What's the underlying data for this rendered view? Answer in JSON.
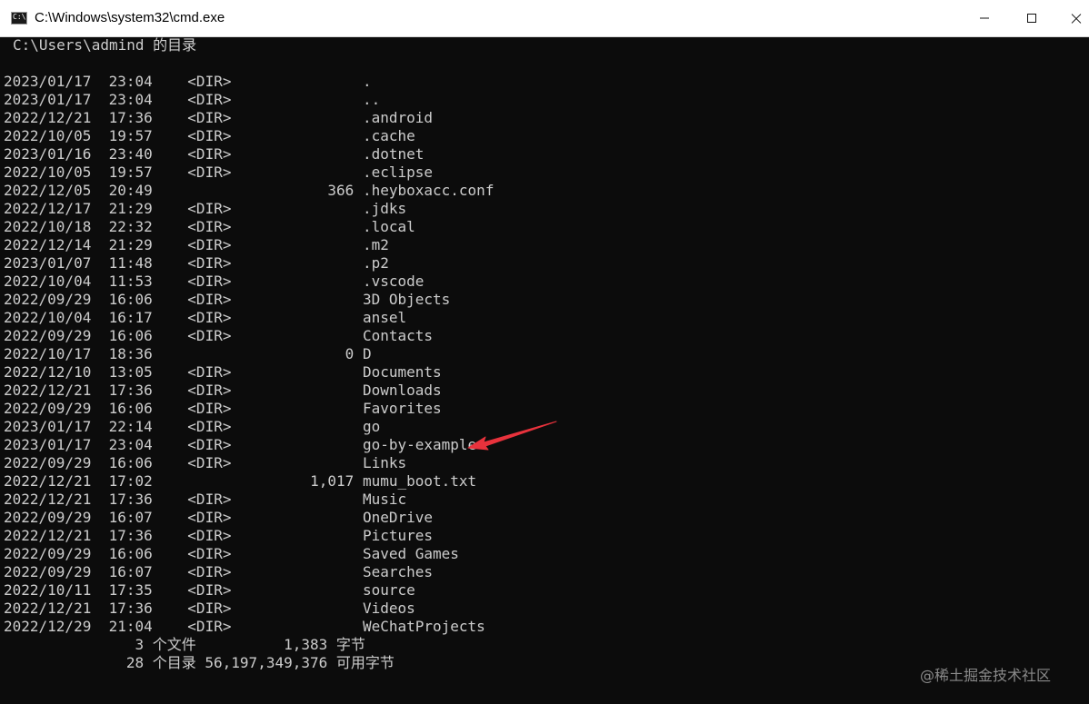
{
  "window": {
    "title": "C:\\Windows\\system32\\cmd.exe",
    "icon_name": "cmd-icon",
    "icon_text": "C:\\"
  },
  "console": {
    "header": "C:\\Users\\admind 的目录",
    "entries": [
      {
        "date": "2023/01/17",
        "time": "23:04",
        "type": "<DIR>",
        "size": "",
        "name": "."
      },
      {
        "date": "2023/01/17",
        "time": "23:04",
        "type": "<DIR>",
        "size": "",
        "name": ".."
      },
      {
        "date": "2022/12/21",
        "time": "17:36",
        "type": "<DIR>",
        "size": "",
        "name": ".android"
      },
      {
        "date": "2022/10/05",
        "time": "19:57",
        "type": "<DIR>",
        "size": "",
        "name": ".cache"
      },
      {
        "date": "2023/01/16",
        "time": "23:40",
        "type": "<DIR>",
        "size": "",
        "name": ".dotnet"
      },
      {
        "date": "2022/10/05",
        "time": "19:57",
        "type": "<DIR>",
        "size": "",
        "name": ".eclipse"
      },
      {
        "date": "2022/12/05",
        "time": "20:49",
        "type": "",
        "size": "366",
        "name": ".heyboxacc.conf"
      },
      {
        "date": "2022/12/17",
        "time": "21:29",
        "type": "<DIR>",
        "size": "",
        "name": ".jdks"
      },
      {
        "date": "2022/10/18",
        "time": "22:32",
        "type": "<DIR>",
        "size": "",
        "name": ".local"
      },
      {
        "date": "2022/12/14",
        "time": "21:29",
        "type": "<DIR>",
        "size": "",
        "name": ".m2"
      },
      {
        "date": "2023/01/07",
        "time": "11:48",
        "type": "<DIR>",
        "size": "",
        "name": ".p2"
      },
      {
        "date": "2022/10/04",
        "time": "11:53",
        "type": "<DIR>",
        "size": "",
        "name": ".vscode"
      },
      {
        "date": "2022/09/29",
        "time": "16:06",
        "type": "<DIR>",
        "size": "",
        "name": "3D Objects"
      },
      {
        "date": "2022/10/04",
        "time": "16:17",
        "type": "<DIR>",
        "size": "",
        "name": "ansel"
      },
      {
        "date": "2022/09/29",
        "time": "16:06",
        "type": "<DIR>",
        "size": "",
        "name": "Contacts"
      },
      {
        "date": "2022/10/17",
        "time": "18:36",
        "type": "",
        "size": "0",
        "name": "D"
      },
      {
        "date": "2022/12/10",
        "time": "13:05",
        "type": "<DIR>",
        "size": "",
        "name": "Documents"
      },
      {
        "date": "2022/12/21",
        "time": "17:36",
        "type": "<DIR>",
        "size": "",
        "name": "Downloads"
      },
      {
        "date": "2022/09/29",
        "time": "16:06",
        "type": "<DIR>",
        "size": "",
        "name": "Favorites"
      },
      {
        "date": "2023/01/17",
        "time": "22:14",
        "type": "<DIR>",
        "size": "",
        "name": "go"
      },
      {
        "date": "2023/01/17",
        "time": "23:04",
        "type": "<DIR>",
        "size": "",
        "name": "go-by-example"
      },
      {
        "date": "2022/09/29",
        "time": "16:06",
        "type": "<DIR>",
        "size": "",
        "name": "Links"
      },
      {
        "date": "2022/12/21",
        "time": "17:02",
        "type": "",
        "size": "1,017",
        "name": "mumu_boot.txt"
      },
      {
        "date": "2022/12/21",
        "time": "17:36",
        "type": "<DIR>",
        "size": "",
        "name": "Music"
      },
      {
        "date": "2022/09/29",
        "time": "16:07",
        "type": "<DIR>",
        "size": "",
        "name": "OneDrive"
      },
      {
        "date": "2022/12/21",
        "time": "17:36",
        "type": "<DIR>",
        "size": "",
        "name": "Pictures"
      },
      {
        "date": "2022/09/29",
        "time": "16:06",
        "type": "<DIR>",
        "size": "",
        "name": "Saved Games"
      },
      {
        "date": "2022/09/29",
        "time": "16:07",
        "type": "<DIR>",
        "size": "",
        "name": "Searches"
      },
      {
        "date": "2022/10/11",
        "time": "17:35",
        "type": "<DIR>",
        "size": "",
        "name": "source"
      },
      {
        "date": "2022/12/21",
        "time": "17:36",
        "type": "<DIR>",
        "size": "",
        "name": "Videos"
      },
      {
        "date": "2022/12/29",
        "time": "21:04",
        "type": "<DIR>",
        "size": "",
        "name": "WeChatProjects"
      }
    ],
    "summary": {
      "files": "               3 个文件          1,383 字节",
      "dirs": "              28 个目录 56,197,349,376 可用字节"
    }
  },
  "annotation": {
    "color": "#e8323c"
  },
  "watermark": "@稀土掘金技术社区",
  "colors": {
    "console_bg": "#0c0c0c",
    "console_fg": "#cccccc"
  }
}
